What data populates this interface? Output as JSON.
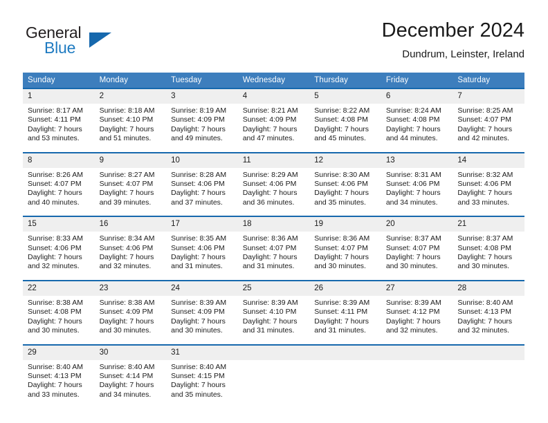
{
  "logo": {
    "text_top": "General",
    "text_bottom": "Blue",
    "triangle_color": "#1668ad",
    "blue_color": "#1f7bc1"
  },
  "header": {
    "title": "December 2024",
    "subtitle": "Dundrum, Leinster, Ireland"
  },
  "theme": {
    "header_bg": "#3d7ebd",
    "cell_top_border": "#1668ad",
    "daynum_bg": "#efefef"
  },
  "weekdays": [
    "Sunday",
    "Monday",
    "Tuesday",
    "Wednesday",
    "Thursday",
    "Friday",
    "Saturday"
  ],
  "weeks": [
    [
      {
        "day": "1",
        "sunrise": "Sunrise: 8:17 AM",
        "sunset": "Sunset: 4:11 PM",
        "daylight1": "Daylight: 7 hours",
        "daylight2": "and 53 minutes."
      },
      {
        "day": "2",
        "sunrise": "Sunrise: 8:18 AM",
        "sunset": "Sunset: 4:10 PM",
        "daylight1": "Daylight: 7 hours",
        "daylight2": "and 51 minutes."
      },
      {
        "day": "3",
        "sunrise": "Sunrise: 8:19 AM",
        "sunset": "Sunset: 4:09 PM",
        "daylight1": "Daylight: 7 hours",
        "daylight2": "and 49 minutes."
      },
      {
        "day": "4",
        "sunrise": "Sunrise: 8:21 AM",
        "sunset": "Sunset: 4:09 PM",
        "daylight1": "Daylight: 7 hours",
        "daylight2": "and 47 minutes."
      },
      {
        "day": "5",
        "sunrise": "Sunrise: 8:22 AM",
        "sunset": "Sunset: 4:08 PM",
        "daylight1": "Daylight: 7 hours",
        "daylight2": "and 45 minutes."
      },
      {
        "day": "6",
        "sunrise": "Sunrise: 8:24 AM",
        "sunset": "Sunset: 4:08 PM",
        "daylight1": "Daylight: 7 hours",
        "daylight2": "and 44 minutes."
      },
      {
        "day": "7",
        "sunrise": "Sunrise: 8:25 AM",
        "sunset": "Sunset: 4:07 PM",
        "daylight1": "Daylight: 7 hours",
        "daylight2": "and 42 minutes."
      }
    ],
    [
      {
        "day": "8",
        "sunrise": "Sunrise: 8:26 AM",
        "sunset": "Sunset: 4:07 PM",
        "daylight1": "Daylight: 7 hours",
        "daylight2": "and 40 minutes."
      },
      {
        "day": "9",
        "sunrise": "Sunrise: 8:27 AM",
        "sunset": "Sunset: 4:07 PM",
        "daylight1": "Daylight: 7 hours",
        "daylight2": "and 39 minutes."
      },
      {
        "day": "10",
        "sunrise": "Sunrise: 8:28 AM",
        "sunset": "Sunset: 4:06 PM",
        "daylight1": "Daylight: 7 hours",
        "daylight2": "and 37 minutes."
      },
      {
        "day": "11",
        "sunrise": "Sunrise: 8:29 AM",
        "sunset": "Sunset: 4:06 PM",
        "daylight1": "Daylight: 7 hours",
        "daylight2": "and 36 minutes."
      },
      {
        "day": "12",
        "sunrise": "Sunrise: 8:30 AM",
        "sunset": "Sunset: 4:06 PM",
        "daylight1": "Daylight: 7 hours",
        "daylight2": "and 35 minutes."
      },
      {
        "day": "13",
        "sunrise": "Sunrise: 8:31 AM",
        "sunset": "Sunset: 4:06 PM",
        "daylight1": "Daylight: 7 hours",
        "daylight2": "and 34 minutes."
      },
      {
        "day": "14",
        "sunrise": "Sunrise: 8:32 AM",
        "sunset": "Sunset: 4:06 PM",
        "daylight1": "Daylight: 7 hours",
        "daylight2": "and 33 minutes."
      }
    ],
    [
      {
        "day": "15",
        "sunrise": "Sunrise: 8:33 AM",
        "sunset": "Sunset: 4:06 PM",
        "daylight1": "Daylight: 7 hours",
        "daylight2": "and 32 minutes."
      },
      {
        "day": "16",
        "sunrise": "Sunrise: 8:34 AM",
        "sunset": "Sunset: 4:06 PM",
        "daylight1": "Daylight: 7 hours",
        "daylight2": "and 32 minutes."
      },
      {
        "day": "17",
        "sunrise": "Sunrise: 8:35 AM",
        "sunset": "Sunset: 4:06 PM",
        "daylight1": "Daylight: 7 hours",
        "daylight2": "and 31 minutes."
      },
      {
        "day": "18",
        "sunrise": "Sunrise: 8:36 AM",
        "sunset": "Sunset: 4:07 PM",
        "daylight1": "Daylight: 7 hours",
        "daylight2": "and 31 minutes."
      },
      {
        "day": "19",
        "sunrise": "Sunrise: 8:36 AM",
        "sunset": "Sunset: 4:07 PM",
        "daylight1": "Daylight: 7 hours",
        "daylight2": "and 30 minutes."
      },
      {
        "day": "20",
        "sunrise": "Sunrise: 8:37 AM",
        "sunset": "Sunset: 4:07 PM",
        "daylight1": "Daylight: 7 hours",
        "daylight2": "and 30 minutes."
      },
      {
        "day": "21",
        "sunrise": "Sunrise: 8:37 AM",
        "sunset": "Sunset: 4:08 PM",
        "daylight1": "Daylight: 7 hours",
        "daylight2": "and 30 minutes."
      }
    ],
    [
      {
        "day": "22",
        "sunrise": "Sunrise: 8:38 AM",
        "sunset": "Sunset: 4:08 PM",
        "daylight1": "Daylight: 7 hours",
        "daylight2": "and 30 minutes."
      },
      {
        "day": "23",
        "sunrise": "Sunrise: 8:38 AM",
        "sunset": "Sunset: 4:09 PM",
        "daylight1": "Daylight: 7 hours",
        "daylight2": "and 30 minutes."
      },
      {
        "day": "24",
        "sunrise": "Sunrise: 8:39 AM",
        "sunset": "Sunset: 4:09 PM",
        "daylight1": "Daylight: 7 hours",
        "daylight2": "and 30 minutes."
      },
      {
        "day": "25",
        "sunrise": "Sunrise: 8:39 AM",
        "sunset": "Sunset: 4:10 PM",
        "daylight1": "Daylight: 7 hours",
        "daylight2": "and 31 minutes."
      },
      {
        "day": "26",
        "sunrise": "Sunrise: 8:39 AM",
        "sunset": "Sunset: 4:11 PM",
        "daylight1": "Daylight: 7 hours",
        "daylight2": "and 31 minutes."
      },
      {
        "day": "27",
        "sunrise": "Sunrise: 8:39 AM",
        "sunset": "Sunset: 4:12 PM",
        "daylight1": "Daylight: 7 hours",
        "daylight2": "and 32 minutes."
      },
      {
        "day": "28",
        "sunrise": "Sunrise: 8:40 AM",
        "sunset": "Sunset: 4:13 PM",
        "daylight1": "Daylight: 7 hours",
        "daylight2": "and 32 minutes."
      }
    ],
    [
      {
        "day": "29",
        "sunrise": "Sunrise: 8:40 AM",
        "sunset": "Sunset: 4:13 PM",
        "daylight1": "Daylight: 7 hours",
        "daylight2": "and 33 minutes."
      },
      {
        "day": "30",
        "sunrise": "Sunrise: 8:40 AM",
        "sunset": "Sunset: 4:14 PM",
        "daylight1": "Daylight: 7 hours",
        "daylight2": "and 34 minutes."
      },
      {
        "day": "31",
        "sunrise": "Sunrise: 8:40 AM",
        "sunset": "Sunset: 4:15 PM",
        "daylight1": "Daylight: 7 hours",
        "daylight2": "and 35 minutes."
      },
      {
        "day": "",
        "sunrise": "",
        "sunset": "",
        "daylight1": "",
        "daylight2": ""
      },
      {
        "day": "",
        "sunrise": "",
        "sunset": "",
        "daylight1": "",
        "daylight2": ""
      },
      {
        "day": "",
        "sunrise": "",
        "sunset": "",
        "daylight1": "",
        "daylight2": ""
      },
      {
        "day": "",
        "sunrise": "",
        "sunset": "",
        "daylight1": "",
        "daylight2": ""
      }
    ]
  ]
}
